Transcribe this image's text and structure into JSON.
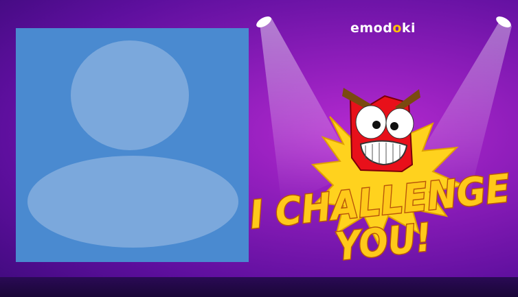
{
  "brand": {
    "logo_part1": "emod",
    "logo_part2": "o",
    "logo_part3": "ki"
  },
  "banner": {
    "line1": "I CHALLENGE",
    "line2": "YOU!"
  },
  "avatar": {
    "icon": "default-user-silhouette"
  },
  "mascot": {
    "icon": "angry-red-emoji-mascot"
  },
  "colors": {
    "background": "#8a1cb8",
    "avatar_bg": "#4a8ad0",
    "title_fill": "#ffc91a",
    "mascot_red": "#e8101a"
  }
}
